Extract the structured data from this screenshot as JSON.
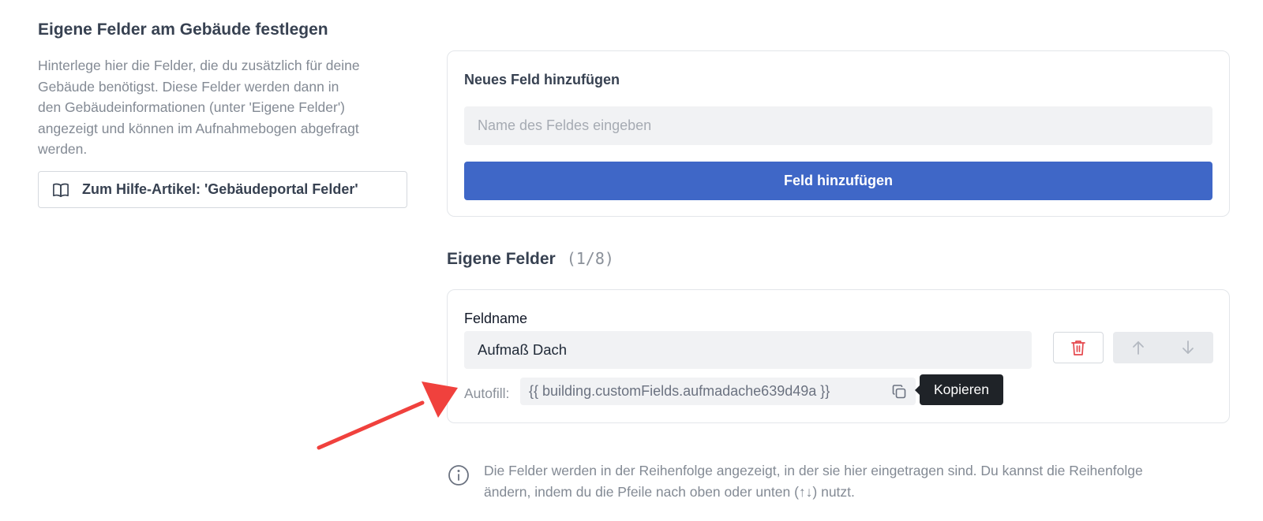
{
  "left": {
    "title": "Eigene Felder am Gebäude festlegen",
    "description": "Hinterlege hier die Felder, die du zusätzlich für deine Gebäude benötigst. Diese Felder werden dann in den Gebäudeinformationen (unter 'Eigene Felder') angezeigt und können im Aufnahmebogen abgefragt werden.",
    "help_button_label": "Zum Hilfe-Artikel: 'Gebäudeportal Felder'",
    "help_button_icon": "book-open-icon"
  },
  "add_card": {
    "title": "Neues Feld hinzufügen",
    "input_placeholder": "Name des Feldes eingeben",
    "input_value": "",
    "button_label": "Feld hinzufügen",
    "button_color": "#3f67c7"
  },
  "fields_section": {
    "title": "Eigene Felder",
    "count": "(1/8)"
  },
  "field": {
    "label": "Feldname",
    "value": "Aufmaß Dach",
    "delete_icon": "trash-icon",
    "delete_color": "#e5484d",
    "move_up_icon": "arrow-up-icon",
    "move_down_icon": "arrow-down-icon",
    "autofill_label": "Autofill:",
    "autofill_code": "{{ building.customFields.aufmadache639d49a }}",
    "copy_icon": "copy-icon",
    "tooltip": "Kopieren"
  },
  "info": {
    "icon": "info-icon",
    "text": "Die Felder werden in der Reihenfolge angezeigt, in der sie hier eingetragen sind. Du kannst die Reihenfolge ändern, indem du die Pfeile nach oben oder unten (↑↓) nutzt."
  },
  "annotation": {
    "arrow_color": "#f0413d"
  }
}
